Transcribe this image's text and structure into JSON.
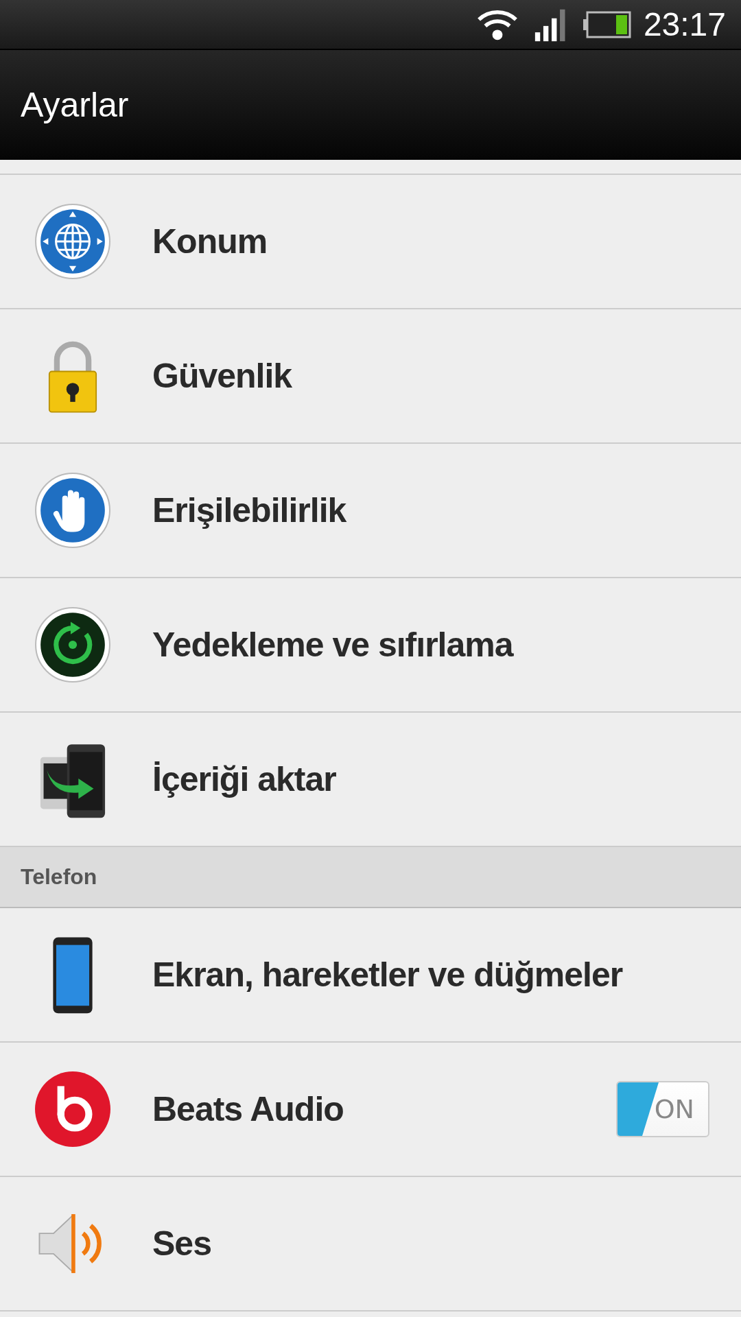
{
  "status_bar": {
    "time": "23:17"
  },
  "action_bar": {
    "title": "Ayarlar"
  },
  "sections": [
    {
      "items": [
        {
          "kind": "globe",
          "label": "Konum"
        },
        {
          "kind": "lock",
          "label": "Güvenlik"
        },
        {
          "kind": "hand",
          "label": "Erişilebilirlik"
        },
        {
          "kind": "backup",
          "label": "Yedekleme ve sıfırlama"
        },
        {
          "kind": "transfer",
          "label": "İçeriği aktar"
        }
      ]
    },
    {
      "header": "Telefon",
      "items": [
        {
          "kind": "phone",
          "label": "Ekran, hareketler ve düğmeler"
        },
        {
          "kind": "beats",
          "label": "Beats Audio",
          "toggle": {
            "on": true,
            "label": "ON"
          }
        },
        {
          "kind": "speaker",
          "label": "Ses"
        }
      ]
    }
  ]
}
